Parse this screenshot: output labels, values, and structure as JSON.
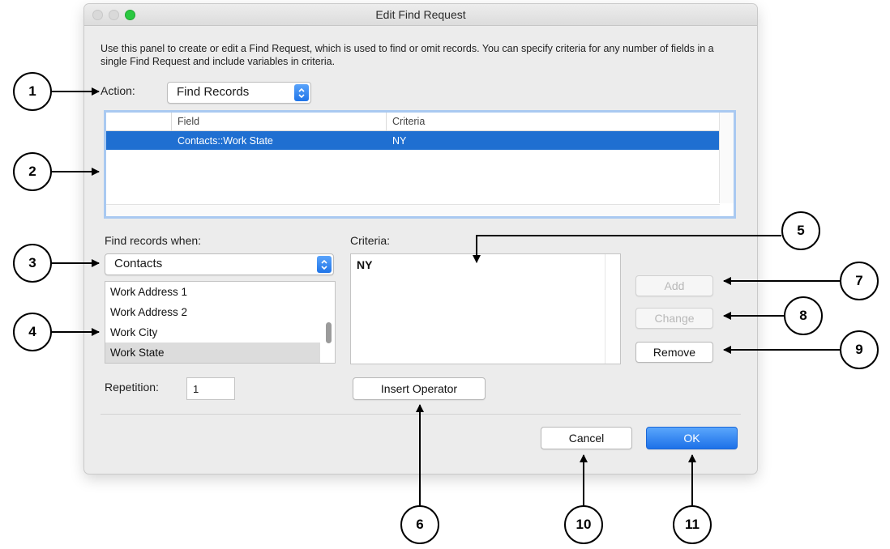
{
  "window": {
    "title": "Edit Find Request"
  },
  "description": "Use this panel to create or edit a Find Request, which is used to find or omit records. You can specify criteria for any number of fields in a single Find Request and include variables in criteria.",
  "action": {
    "label": "Action:",
    "value": "Find Records"
  },
  "request_table": {
    "columns": [
      "Field",
      "Criteria"
    ],
    "rows": [
      {
        "field": "Contacts::Work State",
        "criteria": "NY"
      }
    ]
  },
  "find_when": {
    "label": "Find records when:",
    "table_value": "Contacts",
    "fields": [
      "Work Address 1",
      "Work Address 2",
      "Work City",
      "Work State"
    ],
    "selected_field": "Work State"
  },
  "criteria": {
    "label": "Criteria:",
    "value": "NY"
  },
  "buttons": {
    "add": "Add",
    "change": "Change",
    "remove": "Remove",
    "insert_operator": "Insert Operator",
    "cancel": "Cancel",
    "ok": "OK"
  },
  "repetition": {
    "label": "Repetition:",
    "value": "1"
  },
  "callouts": [
    "1",
    "2",
    "3",
    "4",
    "5",
    "6",
    "7",
    "8",
    "9",
    "10",
    "11"
  ],
  "colors": {
    "accent": "#1f6fd1",
    "zoom_button": "#2ac840",
    "table_focus_ring": "#a9c9f1"
  }
}
